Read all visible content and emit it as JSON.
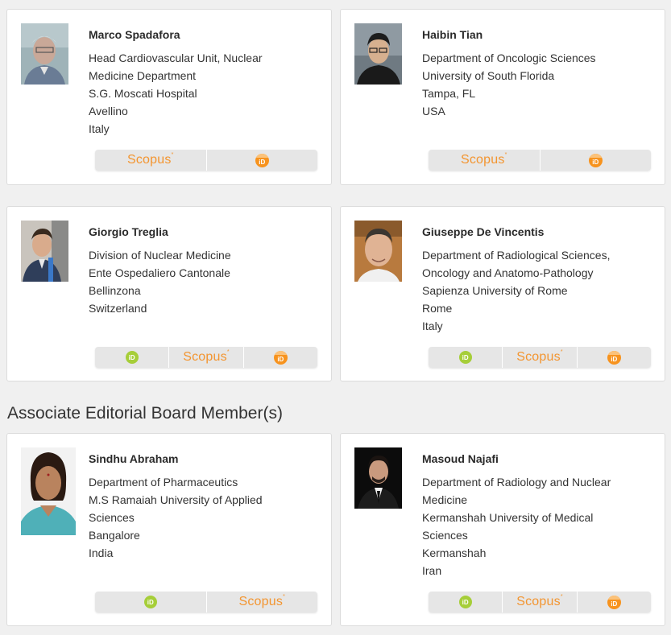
{
  "section_heading": "Associate Editorial Board Member(s)",
  "link_labels": {
    "scopus": "Scopus",
    "scopus_mark": "*",
    "orcid": "iD",
    "pubid": "iD"
  },
  "colors": {
    "scopus": "#f39530",
    "orcid": "#a6ce39",
    "pubid": "#f7931e",
    "card_border": "#dcdcdc"
  },
  "members": [
    {
      "name": "Marco Spadafora",
      "lines": [
        "Head Cardiovascular Unit, Nuclear",
        "Medicine Department",
        "S.G. Moscati Hospital",
        "Avellino",
        "Italy"
      ],
      "links": [
        "scopus",
        "pubid"
      ]
    },
    {
      "name": "Haibin Tian",
      "lines": [
        "Department of Oncologic Sciences",
        "University of South Florida",
        "Tampa, FL",
        "USA"
      ],
      "links": [
        "scopus",
        "pubid"
      ]
    },
    {
      "name": "Giorgio Treglia",
      "lines": [
        "Division of Nuclear Medicine",
        "Ente Ospedaliero Cantonale",
        "Bellinzona",
        "Switzerland"
      ],
      "links": [
        "orcid",
        "scopus",
        "pubid"
      ]
    },
    {
      "name": "Giuseppe De Vincentis",
      "lines": [
        "Department of Radiological Sciences,",
        "Oncology and Anatomo-Pathology",
        "Sapienza University of Rome",
        "Rome",
        "Italy"
      ],
      "links": [
        "orcid",
        "scopus",
        "pubid"
      ]
    },
    {
      "name": "Sindhu Abraham",
      "lines": [
        "Department of Pharmaceutics",
        "M.S Ramaiah University of Applied",
        "Sciences",
        "Bangalore",
        "India"
      ],
      "links": [
        "orcid",
        "scopus"
      ]
    },
    {
      "name": "Masoud Najafi",
      "lines": [
        "Department of Radiology and Nuclear",
        "Medicine",
        "Kermanshah University of Medical",
        "Sciences",
        "Kermanshah",
        "Iran"
      ],
      "links": [
        "orcid",
        "scopus",
        "pubid"
      ]
    }
  ]
}
